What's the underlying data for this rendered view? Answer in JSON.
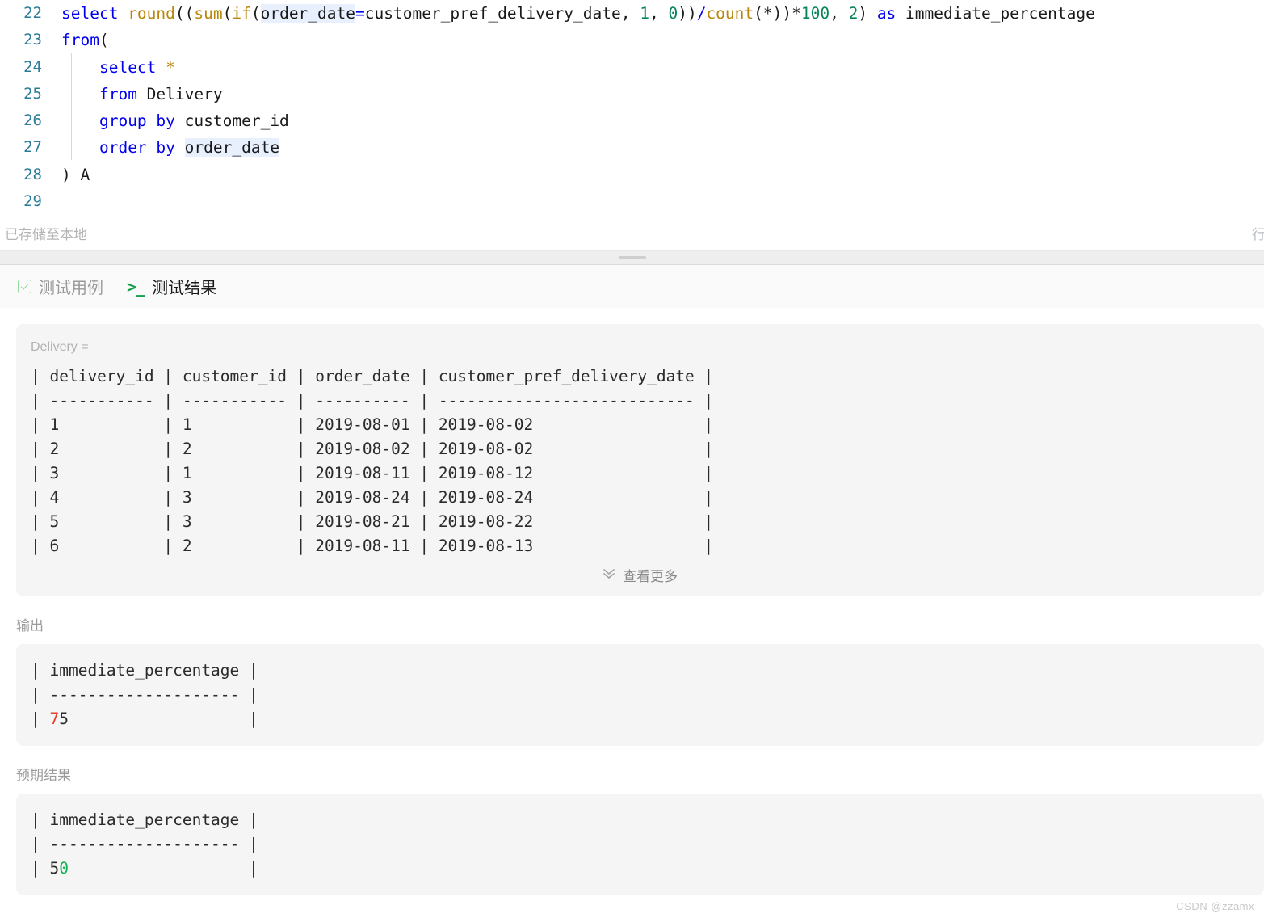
{
  "editor": {
    "lines": [
      {
        "no": "22",
        "segments": [
          {
            "t": "select ",
            "c": "kw"
          },
          {
            "t": "round",
            "c": "fn"
          },
          {
            "t": "((",
            "c": "op"
          },
          {
            "t": "sum",
            "c": "fn"
          },
          {
            "t": "(",
            "c": "op"
          },
          {
            "t": "if",
            "c": "fn"
          },
          {
            "t": "(",
            "c": "op"
          },
          {
            "t": "order_date",
            "c": "hl"
          },
          {
            "t": "=",
            "c": "kw"
          },
          {
            "t": "customer_pref_delivery_date",
            "c": "op"
          },
          {
            "t": ", ",
            "c": "op"
          },
          {
            "t": "1",
            "c": "num"
          },
          {
            "t": ", ",
            "c": "op"
          },
          {
            "t": "0",
            "c": "num"
          },
          {
            "t": "))",
            "c": "op"
          },
          {
            "t": "/",
            "c": "kw"
          },
          {
            "t": "count",
            "c": "fn"
          },
          {
            "t": "(*))",
            "c": "op"
          },
          {
            "t": "*",
            "c": "op"
          },
          {
            "t": "100",
            "c": "num"
          },
          {
            "t": ", ",
            "c": "op"
          },
          {
            "t": "2",
            "c": "num"
          },
          {
            "t": ") ",
            "c": "op"
          },
          {
            "t": "as ",
            "c": "kw"
          },
          {
            "t": "immediate_percentage",
            "c": "op"
          }
        ]
      },
      {
        "no": "23",
        "segments": [
          {
            "t": "from",
            "c": "kw"
          },
          {
            "t": "(",
            "c": "op"
          }
        ]
      },
      {
        "no": "24",
        "segments": [
          {
            "t": "    ",
            "c": "op"
          },
          {
            "t": "select ",
            "c": "kw"
          },
          {
            "t": "*",
            "c": "fn"
          }
        ]
      },
      {
        "no": "25",
        "segments": [
          {
            "t": "    ",
            "c": "op"
          },
          {
            "t": "from ",
            "c": "kw"
          },
          {
            "t": "Delivery",
            "c": "op"
          }
        ]
      },
      {
        "no": "26",
        "segments": [
          {
            "t": "    ",
            "c": "op"
          },
          {
            "t": "group ",
            "c": "kw"
          },
          {
            "t": "by ",
            "c": "kw"
          },
          {
            "t": "customer_id",
            "c": "op"
          }
        ]
      },
      {
        "no": "27",
        "segments": [
          {
            "t": "    ",
            "c": "op"
          },
          {
            "t": "order ",
            "c": "kw"
          },
          {
            "t": "by ",
            "c": "kw"
          },
          {
            "t": "order_date",
            "c": "hl"
          }
        ]
      },
      {
        "no": "28",
        "segments": [
          {
            "t": ") A",
            "c": "op"
          }
        ]
      },
      {
        "no": "29",
        "segments": []
      }
    ]
  },
  "statusbar": {
    "saved_text": "已存储至本地",
    "line_label": "行"
  },
  "tabs": {
    "testcase": {
      "label": "测试用例",
      "icon": "checkbox-check-icon"
    },
    "testresult": {
      "label": "测试结果",
      "icon": "terminal-prompt-icon",
      "prompt": ">_"
    }
  },
  "testcase_panel": {
    "caption": "Delivery =",
    "table_text": "| delivery_id | customer_id | order_date | customer_pref_delivery_date |\n| ----------- | ----------- | ---------- | --------------------------- |\n| 1           | 1           | 2019-08-01 | 2019-08-02                  |\n| 2           | 2           | 2019-08-02 | 2019-08-02                  |\n| 3           | 1           | 2019-08-11 | 2019-08-12                  |\n| 4           | 3           | 2019-08-24 | 2019-08-24                  |\n| 5           | 3           | 2019-08-21 | 2019-08-22                  |\n| 6           | 2           | 2019-08-11 | 2019-08-13                  |",
    "table": {
      "headers": [
        "delivery_id",
        "customer_id",
        "order_date",
        "customer_pref_delivery_date"
      ],
      "rows": [
        [
          "1",
          "1",
          "2019-08-01",
          "2019-08-02"
        ],
        [
          "2",
          "2",
          "2019-08-02",
          "2019-08-02"
        ],
        [
          "3",
          "1",
          "2019-08-11",
          "2019-08-12"
        ],
        [
          "4",
          "3",
          "2019-08-24",
          "2019-08-24"
        ],
        [
          "5",
          "3",
          "2019-08-21",
          "2019-08-22"
        ],
        [
          "6",
          "2",
          "2019-08-11",
          "2019-08-13"
        ]
      ]
    },
    "view_more": "查看更多",
    "chevron": "⌄⌄"
  },
  "output": {
    "label": "输出",
    "header_line": "| immediate_percentage |",
    "divider_line": "| -------------------- |",
    "value_prefix": "| ",
    "value_diff": "7",
    "value_rest": "5",
    "value_suffix": "                   |",
    "value_full": "75"
  },
  "expected": {
    "label": "预期结果",
    "header_line": "| immediate_percentage |",
    "divider_line": "| -------------------- |",
    "value_prefix": "| ",
    "value_same": "5",
    "value_diff": "0",
    "value_suffix": "                   |",
    "value_full": "50"
  },
  "watermark": {
    "text": "CSDN @zzamx"
  },
  "colors": {
    "keyword": "#0000ee",
    "function": "#b8860b",
    "number": "#098658",
    "linenum": "#2d7d9a",
    "highlight": "#e8f0fe",
    "diff_red": "#e8402a",
    "diff_green": "#13b256",
    "panel_bg": "#f5f5f6",
    "accent_green": "#18a04a"
  }
}
